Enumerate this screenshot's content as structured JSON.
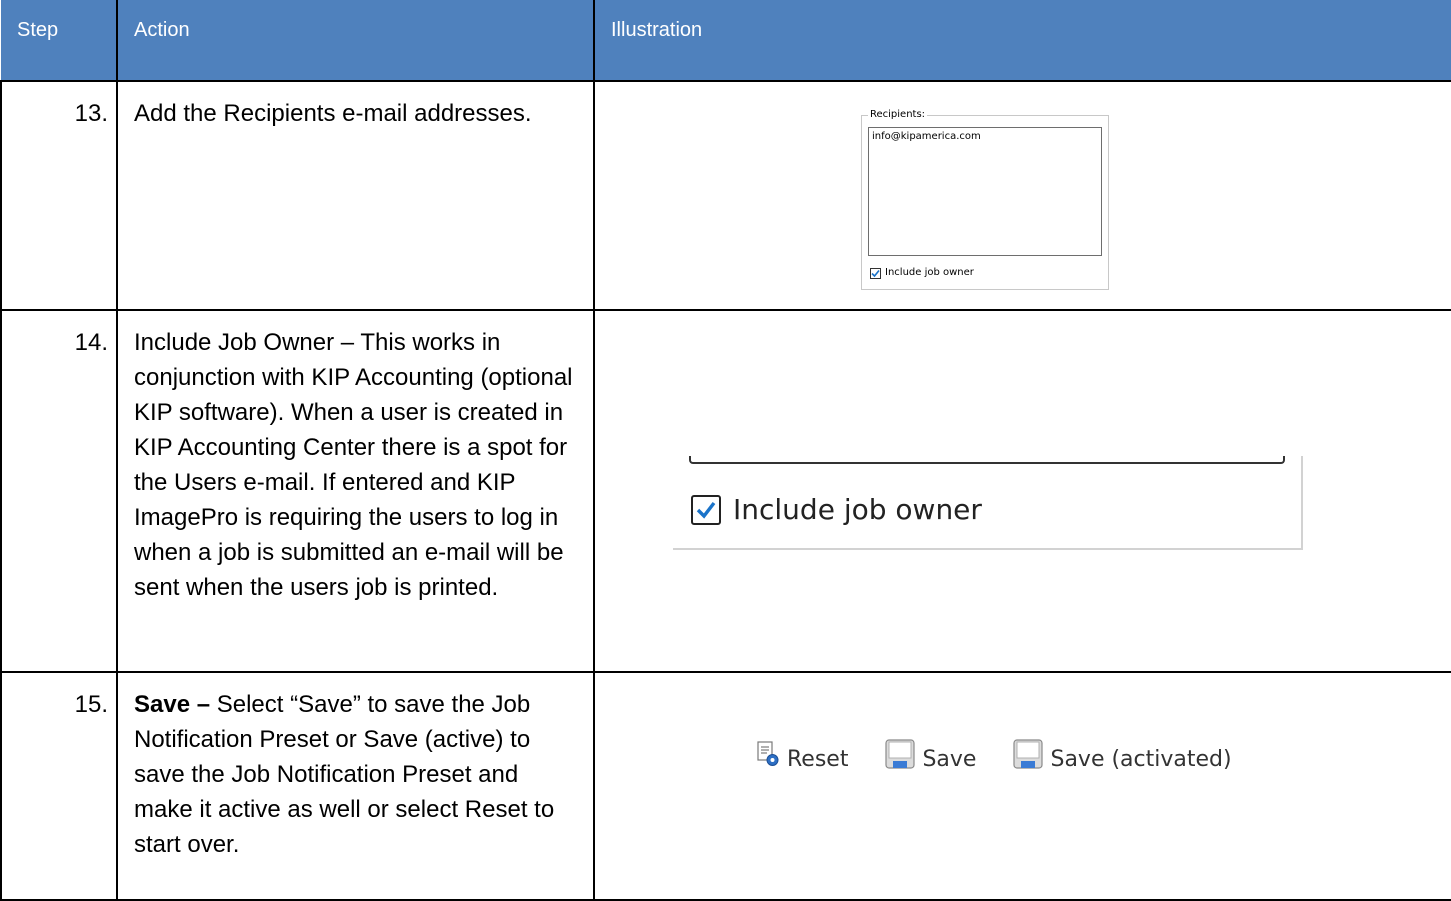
{
  "header": {
    "step": "Step",
    "action": "Action",
    "illustration": "Illustration"
  },
  "rows": [
    {
      "step": "13.",
      "action": "Add the Recipients e-mail addresses.",
      "illustration": {
        "legend": "Recipients:",
        "recipients_value": "info@kipamerica.com",
        "checkbox_label": "Include job owner",
        "checked": true
      }
    },
    {
      "step": "14.",
      "action": "Include Job Owner – This works in conjunction with KIP Accounting (optional KIP software). When a user is created in KIP Accounting Center there is a spot for the Users e-mail. If entered and KIP ImagePro is requiring the users to log in when a job is submitted an e-mail will be sent when the users job is printed.",
      "illustration": {
        "checkbox_label": "Include job owner",
        "checked": true
      }
    },
    {
      "step": "15.",
      "action_bold": "Save –",
      "action": " Select “Save” to save the Job Notification Preset or Save (active) to save the Job Notification Preset and make it active as well or select Reset to start over.",
      "illustration": {
        "buttons": [
          {
            "label": "Reset",
            "icon": "reset-icon"
          },
          {
            "label": "Save",
            "icon": "save-icon"
          },
          {
            "label": "Save (activated)",
            "icon": "save-icon"
          }
        ]
      }
    }
  ],
  "colors": {
    "header_bg": "#4f81bd",
    "header_text": "#ffffff",
    "check_accent": "#1a73c9"
  }
}
